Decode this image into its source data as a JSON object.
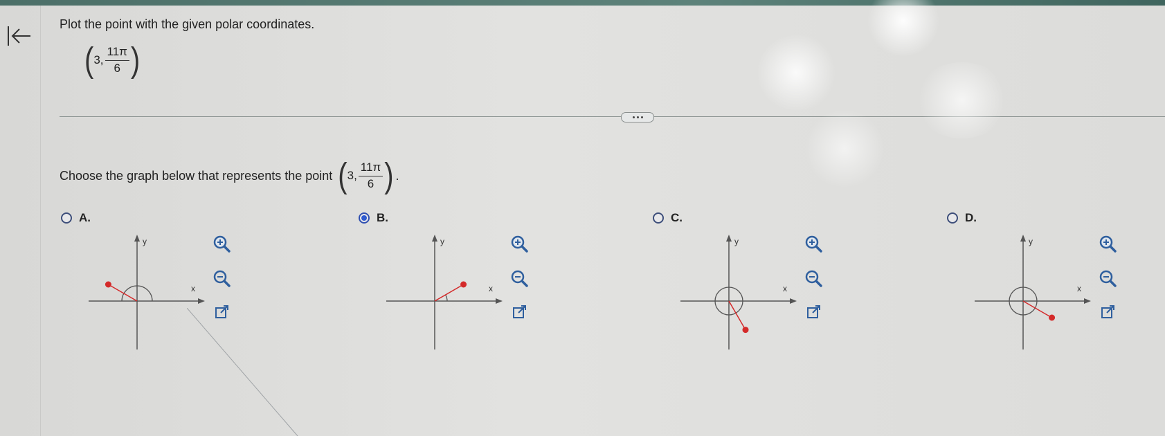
{
  "prompt": "Plot the point with the given polar coordinates.",
  "point": {
    "r": "3",
    "theta_num": "11π",
    "theta_den": "6"
  },
  "question": "Choose the graph below that represents the point",
  "question_end": ".",
  "options": [
    {
      "label": "A.",
      "selected": false,
      "r": 3,
      "angle_deg": 150,
      "axis_x": "x",
      "axis_y": "y"
    },
    {
      "label": "B.",
      "selected": true,
      "r": 3,
      "angle_deg": 30,
      "axis_x": "x",
      "axis_y": "y"
    },
    {
      "label": "C.",
      "selected": false,
      "r": 3,
      "angle_deg": -60,
      "axis_x": "x",
      "axis_y": "y"
    },
    {
      "label": "D.",
      "selected": false,
      "r": 3,
      "angle_deg": -30,
      "axis_x": "x",
      "axis_y": "y"
    }
  ],
  "colors": {
    "point": "#d42a2a",
    "axis": "#555555",
    "arc": "#555555",
    "radio": "#2f5bd0",
    "tool_icon": "#2f5f9e"
  },
  "icons": {
    "back": "back-to-start-icon",
    "zoom_in": "zoom-in-icon",
    "zoom_out": "zoom-out-icon",
    "expand": "open-new-window-icon"
  }
}
